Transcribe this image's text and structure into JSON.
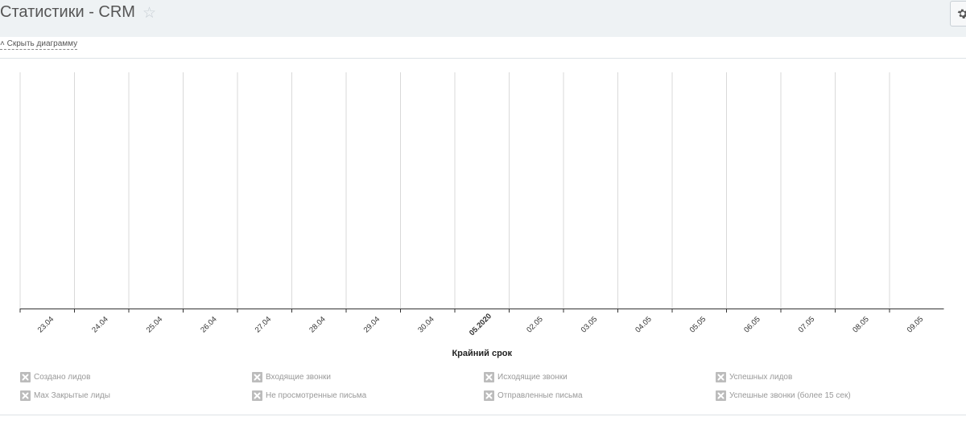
{
  "header": {
    "title": "Статистики - CRM",
    "star_icon": "star-outline-icon",
    "settings_icon": "gear-icon"
  },
  "toolbar": {
    "hide_chart_label": "Скрыть диаграмму"
  },
  "chart_data": {
    "type": "line",
    "categories": [
      "23.04",
      "24.04",
      "25.04",
      "26.04",
      "27.04",
      "28.04",
      "29.04",
      "30.04",
      "05.2020",
      "02.05",
      "03.05",
      "04.05",
      "05.05",
      "06.05",
      "07.05",
      "08.05",
      "09.05"
    ],
    "highlighted_category": "05.2020",
    "xlabel": "Крайний срок",
    "ylabel": "",
    "grid": true,
    "series": []
  },
  "legend": {
    "items": [
      {
        "label": "Создано лидов",
        "enabled": false
      },
      {
        "label": "Входящие звонки",
        "enabled": false
      },
      {
        "label": "Исходящие звонки",
        "enabled": false
      },
      {
        "label": "Успешных лидов",
        "enabled": false
      },
      {
        "label": "Max Закрытые лиды",
        "enabled": false
      },
      {
        "label": "Не просмотренные письма",
        "enabled": false
      },
      {
        "label": "Отправленные письма",
        "enabled": false
      },
      {
        "label": "Успешные звонки (более 15 сек)",
        "enabled": false
      }
    ]
  },
  "colors": {
    "header_bg": "#eef2f4",
    "grid_line": "#d9d9d9",
    "axis_line": "#333333",
    "legend_disabled": "#bcbcbc"
  }
}
